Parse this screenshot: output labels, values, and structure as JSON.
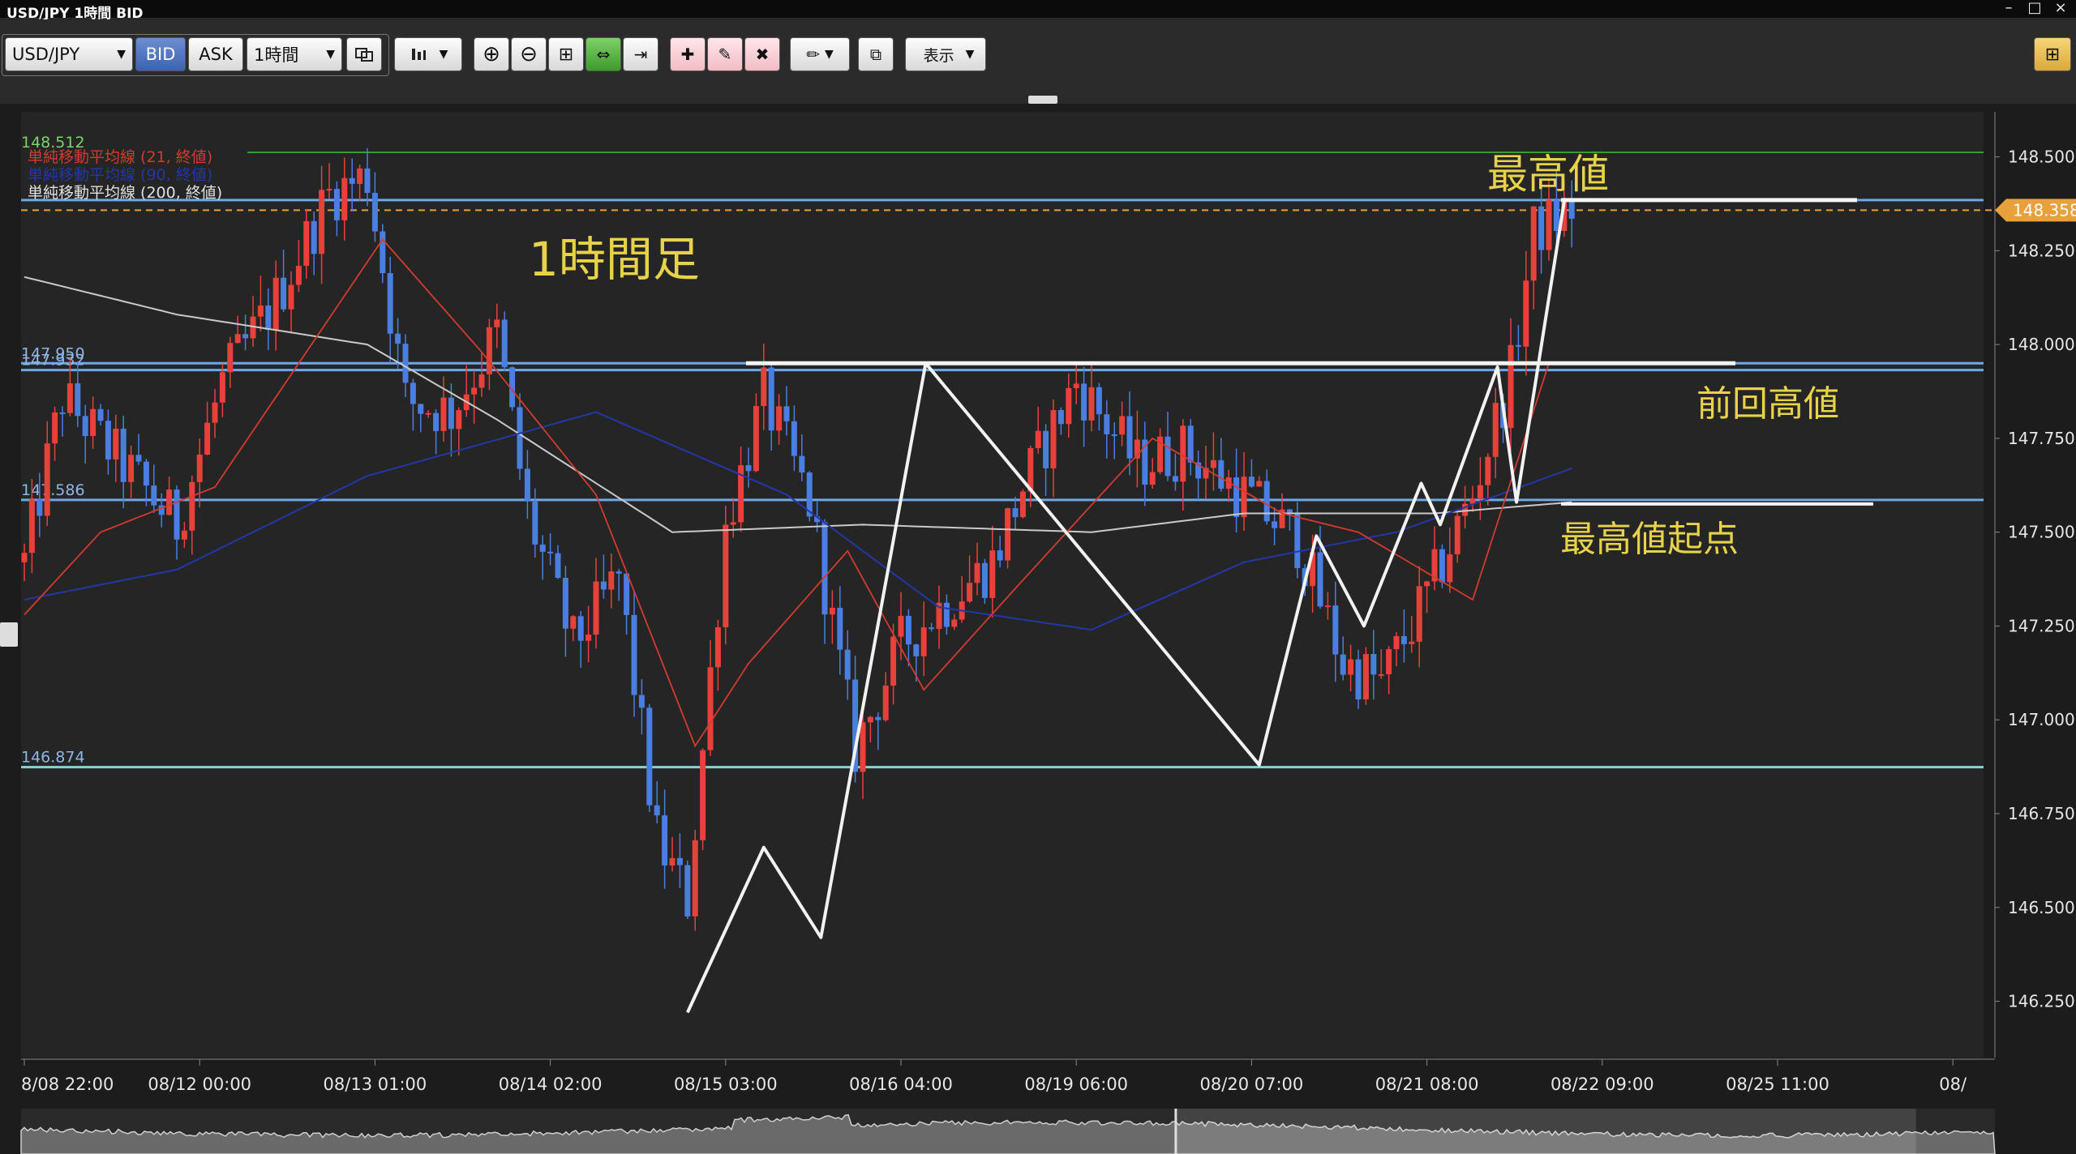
{
  "window": {
    "title": "USD/JPY 1時間 BID"
  },
  "toolbar": {
    "symbol": "USD/JPY",
    "bid_label": "BID",
    "ask_label": "ASK",
    "timeframe": "1時間",
    "display_label": "表示"
  },
  "colors": {
    "background": "#252525",
    "bull_candle": "#e8413c",
    "bear_candle": "#4a7ee0",
    "sma21": "#d43b2f",
    "sma90": "#2436a8",
    "sma200": "#c9c9c9",
    "horizontal_line": "#6fa8e8",
    "support_line": "#7fd9d0",
    "top_line": "#3d9b34",
    "current_price": "#e8a13a",
    "annotation_text": "#e8d24a"
  },
  "chart_data": {
    "type": "candlestick",
    "ylim": [
      146.1,
      148.62
    ],
    "ytick_labels": [
      "148.500",
      "148.250",
      "148.000",
      "147.750",
      "147.500",
      "147.250",
      "147.000",
      "146.750",
      "146.500",
      "146.250"
    ],
    "yticks": [
      148.5,
      148.25,
      148.0,
      147.75,
      147.5,
      147.25,
      147.0,
      146.75,
      146.5,
      146.25
    ],
    "xtick_labels": [
      "8/08 22:00",
      "08/12 00:00",
      "08/13 01:00",
      "08/14 02:00",
      "08/15 03:00",
      "08/16 04:00",
      "08/19 06:00",
      "08/20 07:00",
      "08/21 08:00",
      "08/22 09:00",
      "08/25 11:00",
      "08/"
    ],
    "current_price": 148.358,
    "current_price_label": "148.358",
    "horizontal_levels": [
      {
        "value": 148.512,
        "label": "148.512",
        "style": "top"
      },
      {
        "value": 148.385,
        "label": "",
        "style": "line"
      },
      {
        "value": 147.95,
        "label": "147.950",
        "style": "line"
      },
      {
        "value": 147.932,
        "label": "147.932",
        "style": "line"
      },
      {
        "value": 147.586,
        "label": "147.586",
        "style": "line"
      },
      {
        "value": 146.874,
        "label": "146.874",
        "style": "support"
      }
    ],
    "legend": [
      {
        "name": "単純移動平均線 (21, 終値)",
        "color": "#d43b2f"
      },
      {
        "name": "単純移動平均線 (90, 終値)",
        "color": "#2436a8"
      },
      {
        "name": "単純移動平均線 (200, 終値)",
        "color": "#e0e0e0"
      }
    ],
    "annotations": [
      {
        "text": "1時間足",
        "kind": "title"
      },
      {
        "text": "最高値",
        "kind": "label"
      },
      {
        "text": "前回高値",
        "kind": "label"
      },
      {
        "text": "最高値起点",
        "kind": "label"
      }
    ],
    "zigzag": [
      {
        "x": 0,
        "y": 146.22
      },
      {
        "x": 8,
        "y": 146.66
      },
      {
        "x": 14,
        "y": 146.42
      },
      {
        "x": 25,
        "y": 147.95
      },
      {
        "x": 60,
        "y": 146.88
      },
      {
        "x": 66,
        "y": 147.49
      },
      {
        "x": 71,
        "y": 147.25
      },
      {
        "x": 77,
        "y": 147.63
      },
      {
        "x": 79,
        "y": 147.52
      },
      {
        "x": 85,
        "y": 147.94
      },
      {
        "x": 87,
        "y": 147.58
      },
      {
        "x": 92,
        "y": 148.38
      }
    ],
    "candle_count": 255,
    "price_path": [
      {
        "i": 0,
        "p": 147.42
      },
      {
        "i": 5,
        "p": 147.86
      },
      {
        "i": 12,
        "p": 147.7
      },
      {
        "i": 20,
        "p": 147.52
      },
      {
        "i": 26,
        "p": 147.9
      },
      {
        "i": 33,
        "p": 148.12
      },
      {
        "i": 40,
        "p": 148.4
      },
      {
        "i": 45,
        "p": 148.45
      },
      {
        "i": 50,
        "p": 147.85
      },
      {
        "i": 56,
        "p": 147.82
      },
      {
        "i": 62,
        "p": 148.03
      },
      {
        "i": 66,
        "p": 147.55
      },
      {
        "i": 72,
        "p": 147.2
      },
      {
        "i": 78,
        "p": 147.38
      },
      {
        "i": 83,
        "p": 146.68
      },
      {
        "i": 87,
        "p": 146.52
      },
      {
        "i": 92,
        "p": 147.52
      },
      {
        "i": 97,
        "p": 147.86
      },
      {
        "i": 103,
        "p": 147.58
      },
      {
        "i": 109,
        "p": 146.92
      },
      {
        "i": 115,
        "p": 147.2
      },
      {
        "i": 119,
        "p": 147.28
      },
      {
        "i": 127,
        "p": 147.42
      },
      {
        "i": 131,
        "p": 147.62
      },
      {
        "i": 138,
        "p": 147.9
      },
      {
        "i": 146,
        "p": 147.68
      },
      {
        "i": 152,
        "p": 147.72
      },
      {
        "i": 160,
        "p": 147.6
      },
      {
        "i": 167,
        "p": 147.48
      },
      {
        "i": 173,
        "p": 147.15
      },
      {
        "i": 178,
        "p": 147.1
      },
      {
        "i": 184,
        "p": 147.33
      },
      {
        "i": 190,
        "p": 147.6
      },
      {
        "i": 195,
        "p": 147.92
      },
      {
        "i": 198,
        "p": 148.3
      },
      {
        "i": 203,
        "p": 148.36
      }
    ],
    "sma21": [
      {
        "i": 0,
        "p": 147.28
      },
      {
        "i": 10,
        "p": 147.5
      },
      {
        "i": 25,
        "p": 147.62
      },
      {
        "i": 35,
        "p": 147.92
      },
      {
        "i": 47,
        "p": 148.28
      },
      {
        "i": 60,
        "p": 147.98
      },
      {
        "i": 75,
        "p": 147.6
      },
      {
        "i": 88,
        "p": 146.93
      },
      {
        "i": 95,
        "p": 147.15
      },
      {
        "i": 108,
        "p": 147.45
      },
      {
        "i": 118,
        "p": 147.08
      },
      {
        "i": 130,
        "p": 147.35
      },
      {
        "i": 148,
        "p": 147.75
      },
      {
        "i": 165,
        "p": 147.55
      },
      {
        "i": 175,
        "p": 147.5
      },
      {
        "i": 190,
        "p": 147.32
      },
      {
        "i": 200,
        "p": 147.95
      }
    ],
    "sma90": [
      {
        "i": 0,
        "p": 147.32
      },
      {
        "i": 20,
        "p": 147.4
      },
      {
        "i": 45,
        "p": 147.65
      },
      {
        "i": 75,
        "p": 147.82
      },
      {
        "i": 100,
        "p": 147.6
      },
      {
        "i": 120,
        "p": 147.3
      },
      {
        "i": 140,
        "p": 147.24
      },
      {
        "i": 160,
        "p": 147.42
      },
      {
        "i": 180,
        "p": 147.5
      },
      {
        "i": 203,
        "p": 147.67
      }
    ],
    "sma200": [
      {
        "i": 0,
        "p": 148.18
      },
      {
        "i": 20,
        "p": 148.08
      },
      {
        "i": 45,
        "p": 148.0
      },
      {
        "i": 62,
        "p": 147.8
      },
      {
        "i": 85,
        "p": 147.5
      },
      {
        "i": 110,
        "p": 147.52
      },
      {
        "i": 140,
        "p": 147.5
      },
      {
        "i": 160,
        "p": 147.55
      },
      {
        "i": 185,
        "p": 147.55
      },
      {
        "i": 203,
        "p": 147.58
      }
    ],
    "navigator_selection": [
      0.585,
      0.96
    ]
  }
}
